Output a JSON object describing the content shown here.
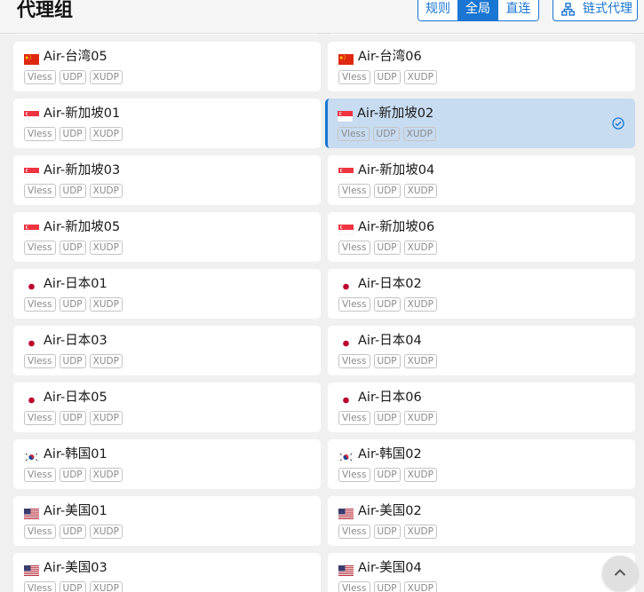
{
  "header": {
    "title": "代理组",
    "modes": [
      {
        "label": "规则",
        "active": false
      },
      {
        "label": "全局",
        "active": true
      },
      {
        "label": "直连",
        "active": false
      }
    ],
    "chain_label": "链式代理"
  },
  "colors": {
    "accent": "#1976d2",
    "selected_bg": "#c7dbf1"
  },
  "proxies": [
    {
      "name": "",
      "flag": "none",
      "tags": [
        "",
        "",
        ""
      ]
    },
    {
      "name": "",
      "flag": "none",
      "tags": [
        "",
        "",
        ""
      ]
    },
    {
      "name": "Air-台湾05",
      "flag": "cn",
      "tags": [
        "Vless",
        "UDP",
        "XUDP"
      ]
    },
    {
      "name": "Air-台湾06",
      "flag": "cn",
      "tags": [
        "Vless",
        "UDP",
        "XUDP"
      ]
    },
    {
      "name": "Air-新加坡01",
      "flag": "sg",
      "tags": [
        "Vless",
        "UDP",
        "XUDP"
      ]
    },
    {
      "name": "Air-新加坡02",
      "flag": "sg",
      "tags": [
        "Vless",
        "UDP",
        "XUDP"
      ],
      "selected": true
    },
    {
      "name": "Air-新加坡03",
      "flag": "sg",
      "tags": [
        "Vless",
        "UDP",
        "XUDP"
      ]
    },
    {
      "name": "Air-新加坡04",
      "flag": "sg",
      "tags": [
        "Vless",
        "UDP",
        "XUDP"
      ]
    },
    {
      "name": "Air-新加坡05",
      "flag": "sg",
      "tags": [
        "Vless",
        "UDP",
        "XUDP"
      ]
    },
    {
      "name": "Air-新加坡06",
      "flag": "sg",
      "tags": [
        "Vless",
        "UDP",
        "XUDP"
      ]
    },
    {
      "name": "Air-日本01",
      "flag": "jp",
      "tags": [
        "Vless",
        "UDP",
        "XUDP"
      ]
    },
    {
      "name": "Air-日本02",
      "flag": "jp",
      "tags": [
        "Vless",
        "UDP",
        "XUDP"
      ]
    },
    {
      "name": "Air-日本03",
      "flag": "jp",
      "tags": [
        "Vless",
        "UDP",
        "XUDP"
      ]
    },
    {
      "name": "Air-日本04",
      "flag": "jp",
      "tags": [
        "Vless",
        "UDP",
        "XUDP"
      ]
    },
    {
      "name": "Air-日本05",
      "flag": "jp",
      "tags": [
        "Vless",
        "UDP",
        "XUDP"
      ]
    },
    {
      "name": "Air-日本06",
      "flag": "jp",
      "tags": [
        "Vless",
        "UDP",
        "XUDP"
      ]
    },
    {
      "name": "Air-韩国01",
      "flag": "kr",
      "tags": [
        "Vless",
        "UDP",
        "XUDP"
      ]
    },
    {
      "name": "Air-韩国02",
      "flag": "kr",
      "tags": [
        "Vless",
        "UDP",
        "XUDP"
      ]
    },
    {
      "name": "Air-美国01",
      "flag": "us",
      "tags": [
        "Vless",
        "UDP",
        "XUDP"
      ]
    },
    {
      "name": "Air-美国02",
      "flag": "us",
      "tags": [
        "Vless",
        "UDP",
        "XUDP"
      ]
    },
    {
      "name": "Air-美国03",
      "flag": "us",
      "tags": [
        "Vless",
        "UDP",
        "XUDP"
      ]
    },
    {
      "name": "Air-美国04",
      "flag": "us",
      "tags": [
        "Vless",
        "UDP",
        "XUDP"
      ]
    }
  ]
}
